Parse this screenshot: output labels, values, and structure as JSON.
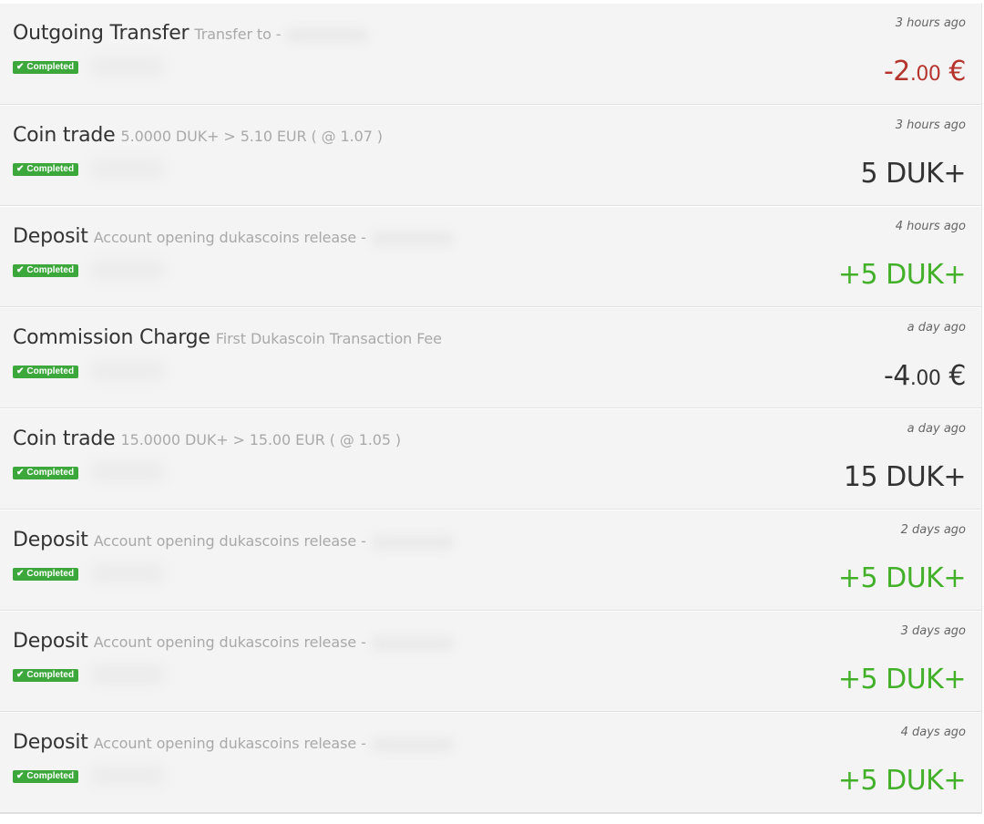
{
  "transactions": [
    {
      "type": "Outgoing Transfer",
      "description": "Transfer to -",
      "status": "Completed",
      "time": "3 hours ago",
      "amount_main": "-2",
      "amount_decimals": ".00",
      "amount_unit": " €",
      "amount_color": "#b5352e"
    },
    {
      "type": "Coin trade",
      "description": "5.0000 DUK+ > 5.10 EUR ( @ 1.07 )",
      "status": "Completed",
      "time": "3 hours ago",
      "amount_main": "5 DUK+",
      "amount_decimals": "",
      "amount_unit": "",
      "amount_color": "#333333"
    },
    {
      "type": "Deposit",
      "description": "Account opening dukascoins release -",
      "status": "Completed",
      "time": "4 hours ago",
      "amount_main": "+5 DUK+",
      "amount_decimals": "",
      "amount_unit": "",
      "amount_color": "#43b02a"
    },
    {
      "type": "Commission Charge",
      "description": "First Dukascoin Transaction Fee",
      "status": "Completed",
      "time": "a day ago",
      "amount_main": "-4",
      "amount_decimals": ".00",
      "amount_unit": " €",
      "amount_color": "#333333"
    },
    {
      "type": "Coin trade",
      "description": "15.0000 DUK+ > 15.00 EUR ( @ 1.05 )",
      "status": "Completed",
      "time": "a day ago",
      "amount_main": "15 DUK+",
      "amount_decimals": "",
      "amount_unit": "",
      "amount_color": "#333333"
    },
    {
      "type": "Deposit",
      "description": "Account opening dukascoins release -",
      "status": "Completed",
      "time": "2 days ago",
      "amount_main": "+5 DUK+",
      "amount_decimals": "",
      "amount_unit": "",
      "amount_color": "#43b02a"
    },
    {
      "type": "Deposit",
      "description": "Account opening dukascoins release -",
      "status": "Completed",
      "time": "3 days ago",
      "amount_main": "+5 DUK+",
      "amount_decimals": "",
      "amount_unit": "",
      "amount_color": "#43b02a"
    },
    {
      "type": "Deposit",
      "description": "Account opening dukascoins release -",
      "status": "Completed",
      "time": "4 days ago",
      "amount_main": "+5 DUK+",
      "amount_decimals": "",
      "amount_unit": "",
      "amount_color": "#43b02a"
    }
  ],
  "badge_color": "#3ca83c",
  "check_icon": "check-icon"
}
